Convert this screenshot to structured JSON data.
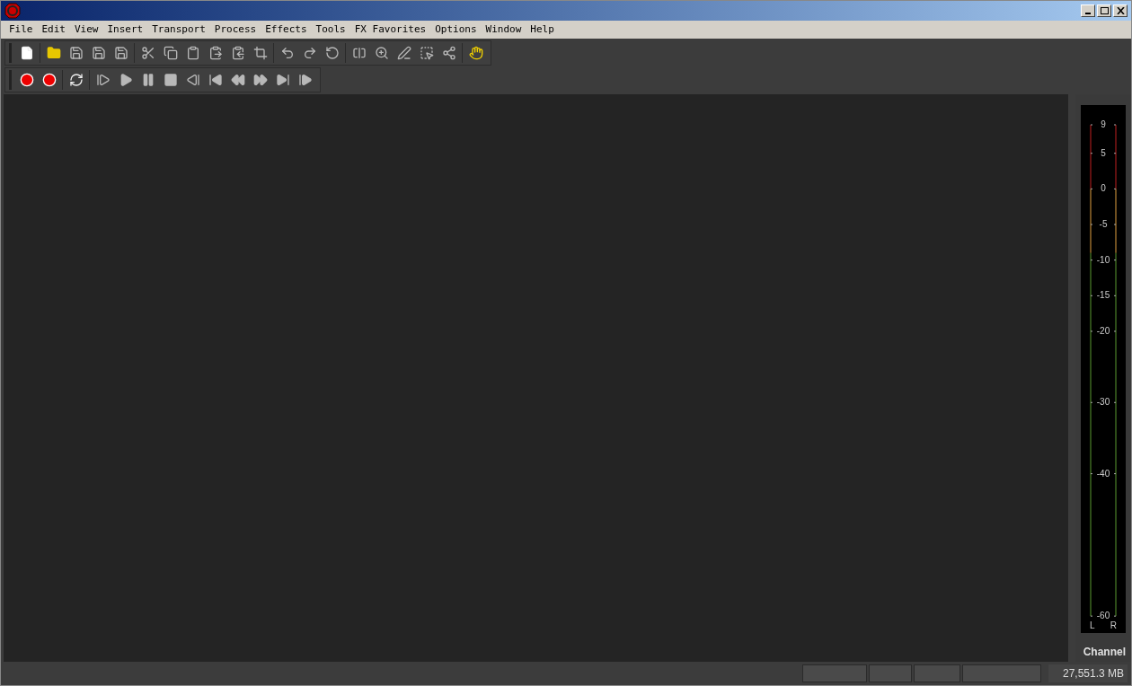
{
  "menu": [
    "File",
    "Edit",
    "View",
    "Insert",
    "Transport",
    "Process",
    "Effects",
    "Tools",
    "FX Favorites",
    "Options",
    "Window",
    "Help"
  ],
  "meter": {
    "marks": [
      "9",
      "5",
      "0",
      "-5",
      "-10",
      "-15",
      "-20",
      "-30",
      "-40",
      "-60"
    ],
    "channels": [
      "L",
      "R"
    ],
    "label": "Channel"
  },
  "status_bar": {
    "memory": "27,551.3 MB"
  }
}
